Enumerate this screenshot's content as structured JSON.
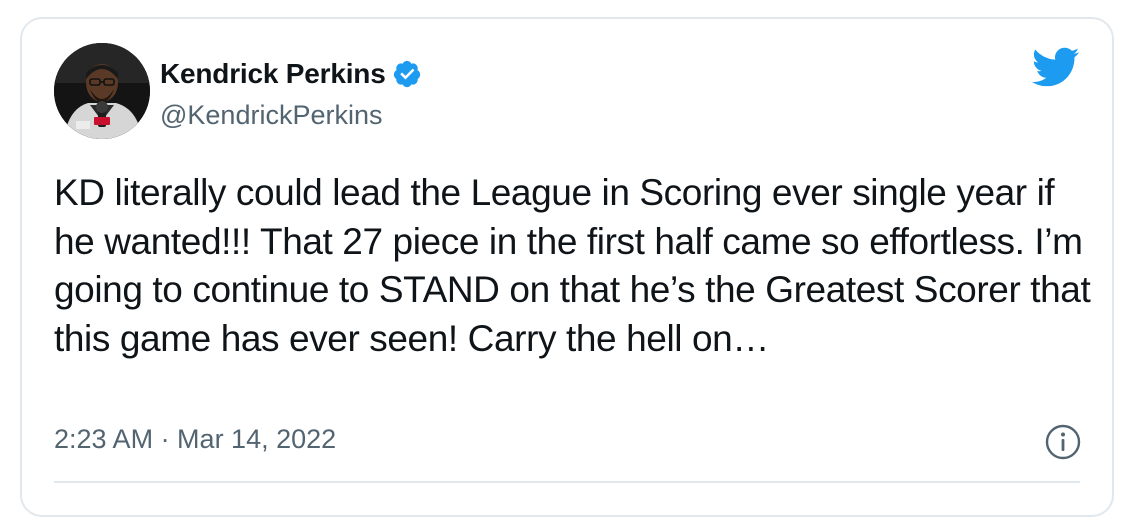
{
  "tweet": {
    "author": {
      "display_name": "Kendrick Perkins",
      "handle": "@KendrickPerkins",
      "verified": true
    },
    "text": "KD literally could lead the League in Scoring ever single year if he wanted!!! That 27 piece in the first half came so effortless. I’m going to continue to STAND on that he’s the Greatest Scorer that this game has ever seen! Carry the hell on…",
    "timestamp": "2:23 AM · Mar 14, 2022"
  },
  "icons": {
    "brand": "twitter-bird-icon",
    "verified": "verified-badge-icon",
    "info": "info-icon"
  },
  "colors": {
    "brand_blue": "#1d9bf0",
    "text_primary": "#0f1419",
    "text_secondary": "#536471",
    "border": "#e1e8ed"
  }
}
